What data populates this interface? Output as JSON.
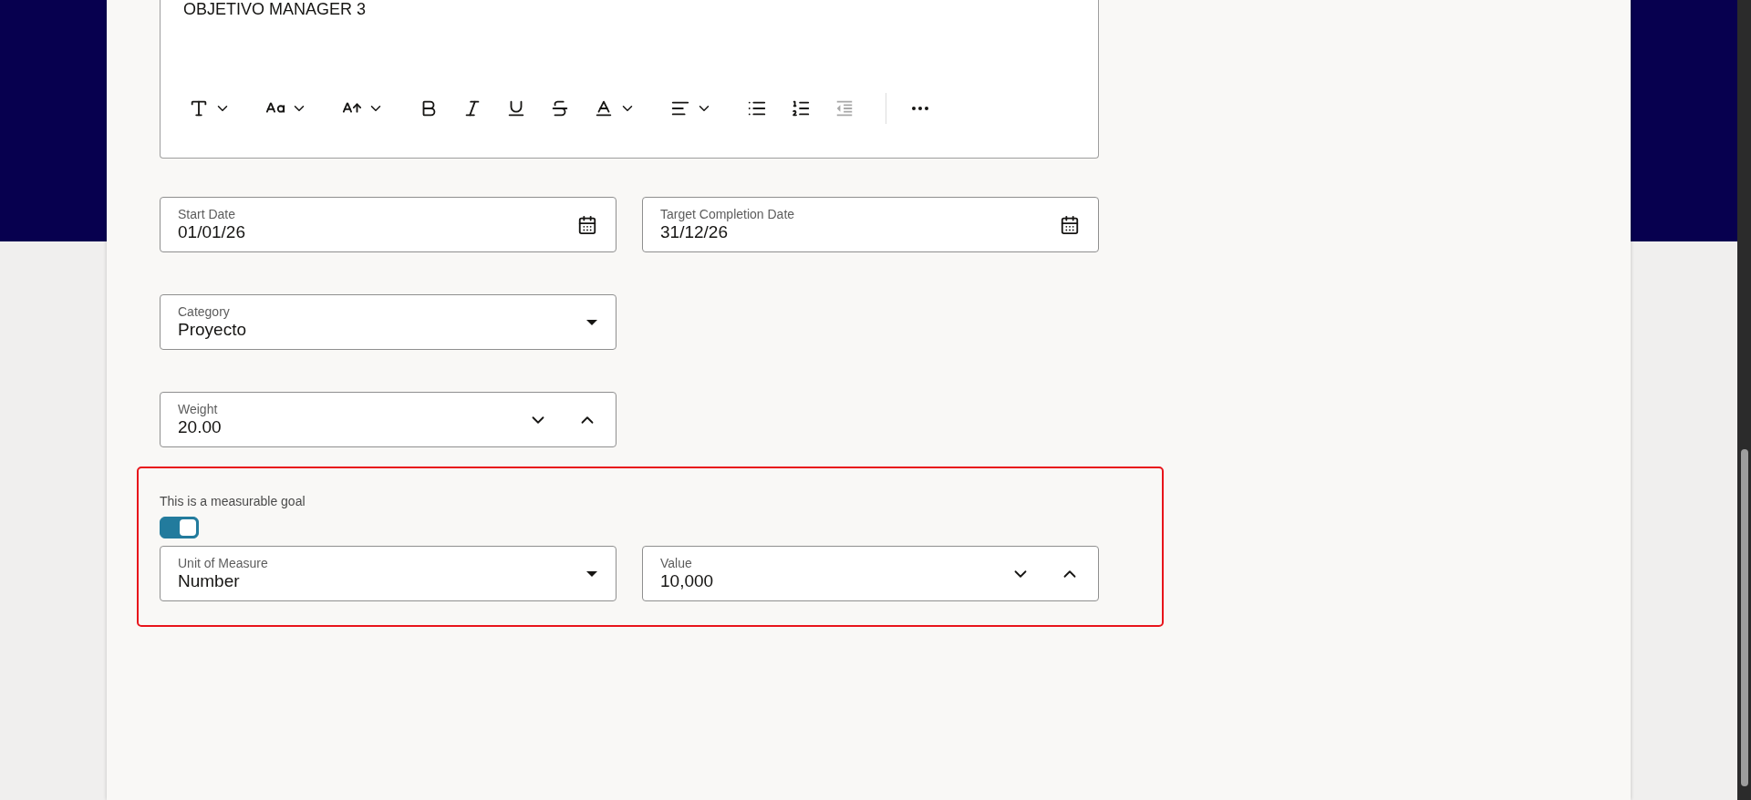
{
  "editor": {
    "text": "OBJETIVO MANAGER 3",
    "toolbar": [
      {
        "kind": "text-size",
        "menu": true,
        "disabled": false
      },
      {
        "kind": "font",
        "menu": true,
        "disabled": false
      },
      {
        "kind": "font-size",
        "menu": true,
        "disabled": false
      },
      {
        "kind": "bold",
        "menu": false,
        "disabled": false
      },
      {
        "kind": "italic",
        "menu": false,
        "disabled": false
      },
      {
        "kind": "underline",
        "menu": false,
        "disabled": false
      },
      {
        "kind": "strikethrough",
        "menu": false,
        "disabled": false
      },
      {
        "kind": "text-color",
        "menu": true,
        "disabled": false
      },
      {
        "kind": "align",
        "menu": true,
        "disabled": false
      },
      {
        "kind": "bullets",
        "menu": false,
        "disabled": false
      },
      {
        "kind": "numbering",
        "menu": false,
        "disabled": false
      },
      {
        "kind": "outdent",
        "menu": false,
        "disabled": true
      },
      {
        "kind": "separator"
      },
      {
        "kind": "more",
        "menu": false,
        "disabled": false
      }
    ]
  },
  "rows": [
    [
      {
        "kind": "date",
        "label": "Start Date",
        "value": "01/01/26"
      },
      {
        "kind": "date",
        "label": "Target Completion Date",
        "value": "31/12/26"
      }
    ],
    [
      {
        "kind": "select",
        "label": "Category",
        "value": "Proyecto"
      }
    ],
    [
      {
        "kind": "number",
        "label": "Weight",
        "value": "20.00"
      }
    ]
  ],
  "measurable": {
    "label": "This is a measurable goal",
    "on": true,
    "fields": [
      {
        "kind": "select",
        "label": "Unit of Measure",
        "value": "Number"
      },
      {
        "kind": "number",
        "label": "Value",
        "value": "10,000"
      }
    ]
  }
}
